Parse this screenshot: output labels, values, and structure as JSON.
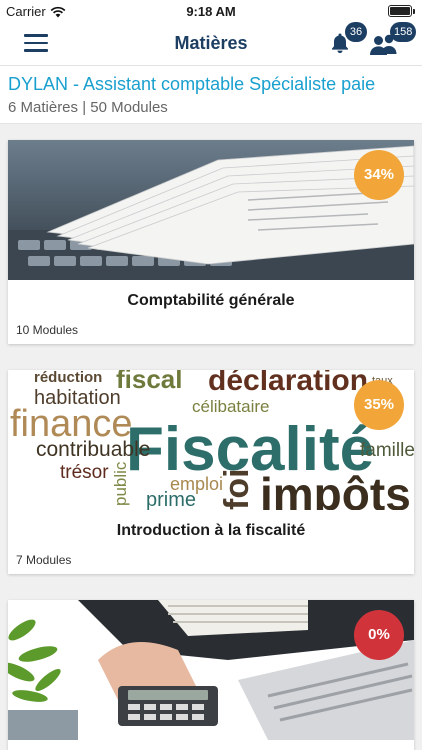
{
  "status_bar": {
    "carrier": "Carrier",
    "time": "9:18 AM"
  },
  "nav": {
    "title": "Matières",
    "notification_count": "36",
    "users_count": "158",
    "accent_color": "#1c3e63"
  },
  "header": {
    "title": "DYLAN - Assistant comptable Spécialiste paie",
    "subtitle": "6 Matières | 50 Modules",
    "title_color": "#1aa0cf"
  },
  "courses": [
    {
      "title": "Comptabilité générale",
      "modules": "10 Modules",
      "progress": "34%",
      "progress_color": "#f2a63a",
      "image_icon": "papers-on-keyboard"
    },
    {
      "title": "Introduction à la fiscalité",
      "modules": "7 Modules",
      "progress": "35%",
      "progress_color": "#f2a63a",
      "image_icon": "fiscalite-word-cloud",
      "image_words": [
        "réduction",
        "habitation",
        "fiscal",
        "déclaration",
        "finance",
        "célibataire",
        "taux",
        "Fiscalité",
        "contribuable",
        "trésor",
        "famille",
        "emploi",
        "public",
        "prime",
        "impôts",
        "foi"
      ]
    },
    {
      "title": "",
      "modules": "",
      "progress": "0%",
      "progress_color": "#d0343a",
      "image_icon": "calculator-and-laptop"
    }
  ]
}
